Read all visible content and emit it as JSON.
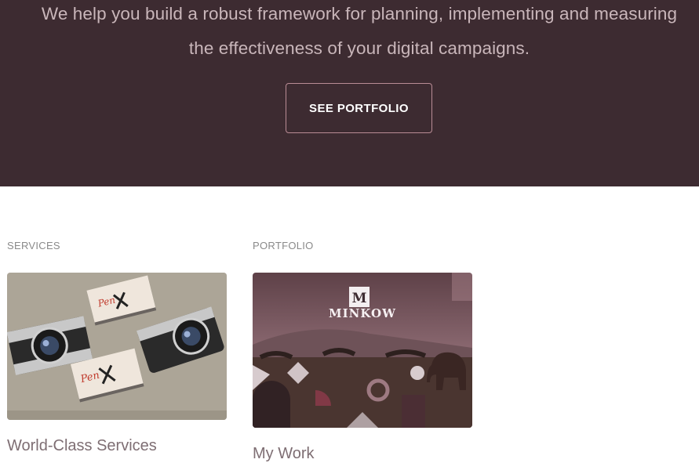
{
  "hero": {
    "line1": "We help you build a robust framework for planning, implementing and measuring",
    "line2": "the effectiveness of your digital campaigns.",
    "button_label": "SEE PORTFOLIO"
  },
  "cards": [
    {
      "label": "SERVICES",
      "title": "World-Class Services",
      "image": "business-cards-cameras-photo"
    },
    {
      "label": "PORTFOLIO",
      "title": "My Work",
      "image": "minkow-safari-collage",
      "logo_text": "MINKOW"
    }
  ],
  "colors": {
    "hero_bg": "#3d2b31",
    "hero_text": "#c9b6ba",
    "button_border": "#b98c95",
    "label_text": "#8a8a8a",
    "title_text": "#7e6e73"
  }
}
